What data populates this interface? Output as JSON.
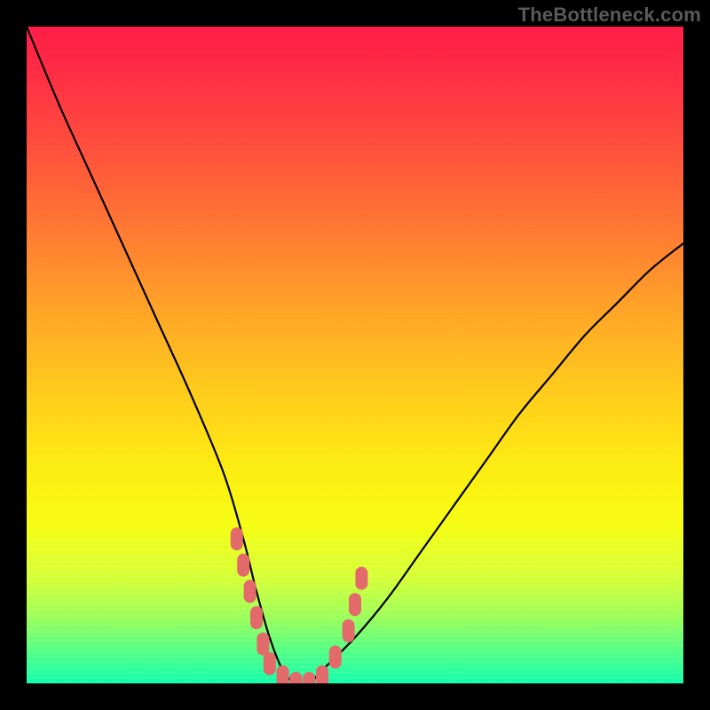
{
  "watermark": "TheBottleneck.com",
  "chart_data": {
    "type": "line",
    "title": "",
    "xlabel": "",
    "ylabel": "",
    "xlim": [
      0,
      100
    ],
    "ylim": [
      0,
      100
    ],
    "grid": false,
    "legend": false,
    "series": [
      {
        "name": "bottleneck-curve",
        "x": [
          0,
          5,
          10,
          15,
          20,
          25,
          30,
          33,
          35,
          37,
          39,
          41,
          43,
          45,
          50,
          55,
          60,
          65,
          70,
          75,
          80,
          85,
          90,
          95,
          100
        ],
        "values": [
          100,
          88,
          77,
          66,
          55,
          44,
          32,
          22,
          14,
          7,
          2,
          0,
          0,
          2,
          7,
          13,
          20,
          27,
          34,
          41,
          47,
          53,
          58,
          63,
          67
        ]
      }
    ],
    "highlight_points": {
      "name": "marker-cluster",
      "color": "#e36a6a",
      "points": [
        {
          "x": 32,
          "y": 22
        },
        {
          "x": 33,
          "y": 18
        },
        {
          "x": 34,
          "y": 14
        },
        {
          "x": 35,
          "y": 10
        },
        {
          "x": 36,
          "y": 6
        },
        {
          "x": 37,
          "y": 3
        },
        {
          "x": 39,
          "y": 1
        },
        {
          "x": 41,
          "y": 0
        },
        {
          "x": 43,
          "y": 0
        },
        {
          "x": 45,
          "y": 1
        },
        {
          "x": 47,
          "y": 4
        },
        {
          "x": 49,
          "y": 8
        },
        {
          "x": 50,
          "y": 12
        },
        {
          "x": 51,
          "y": 16
        }
      ]
    },
    "gradient": {
      "orientation": "vertical",
      "stops": [
        {
          "pos": 0.0,
          "color": "#ff1d47"
        },
        {
          "pos": 0.18,
          "color": "#ff4e3d"
        },
        {
          "pos": 0.46,
          "color": "#ffae25"
        },
        {
          "pos": 0.68,
          "color": "#fcee12"
        },
        {
          "pos": 0.9,
          "color": "#9bff5a"
        },
        {
          "pos": 1.0,
          "color": "#12ffac"
        }
      ]
    }
  }
}
